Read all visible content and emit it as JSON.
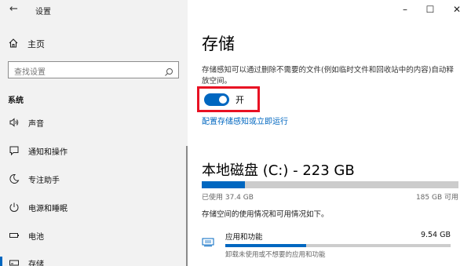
{
  "window": {
    "title": "设置",
    "back_icon": "←",
    "minimize": "–",
    "maximize": "☐",
    "close": "✕"
  },
  "sidebar": {
    "home": "主页",
    "search_placeholder": "查找设置",
    "section": "系统",
    "items": [
      {
        "label": "声音",
        "icon": "speaker-icon"
      },
      {
        "label": "通知和操作",
        "icon": "notification-icon"
      },
      {
        "label": "专注助手",
        "icon": "moon-icon"
      },
      {
        "label": "电源和睡眠",
        "icon": "power-icon"
      },
      {
        "label": "电池",
        "icon": "battery-icon"
      },
      {
        "label": "存储",
        "icon": "storage-icon",
        "selected": true
      }
    ]
  },
  "main": {
    "title": "存储",
    "description": "存储感知可以通过删除不需要的文件(例如临时文件和回收站中的内容)自动释放空间。",
    "toggle": {
      "label": "开",
      "on": true
    },
    "link": "配置存储感知或立即运行",
    "disk": {
      "title": "本地磁盘 (C:) - 223 GB",
      "used": "已使用 37.4 GB",
      "free": "185 GB 可用",
      "used_fraction": 0.168,
      "info": "存储空间的使用情况和可用情况如下。"
    },
    "categories": [
      {
        "label": "应用和功能",
        "size": "9.54 GB",
        "sub": "卸载未使用或不想要的应用和功能",
        "fraction": 0.36,
        "icon": "apps-icon"
      }
    ]
  },
  "colors": {
    "accent": "#0067c0",
    "highlight": "#e81123",
    "sidebar_bg": "#f2f2f2",
    "bar_bg": "#cccccc"
  }
}
